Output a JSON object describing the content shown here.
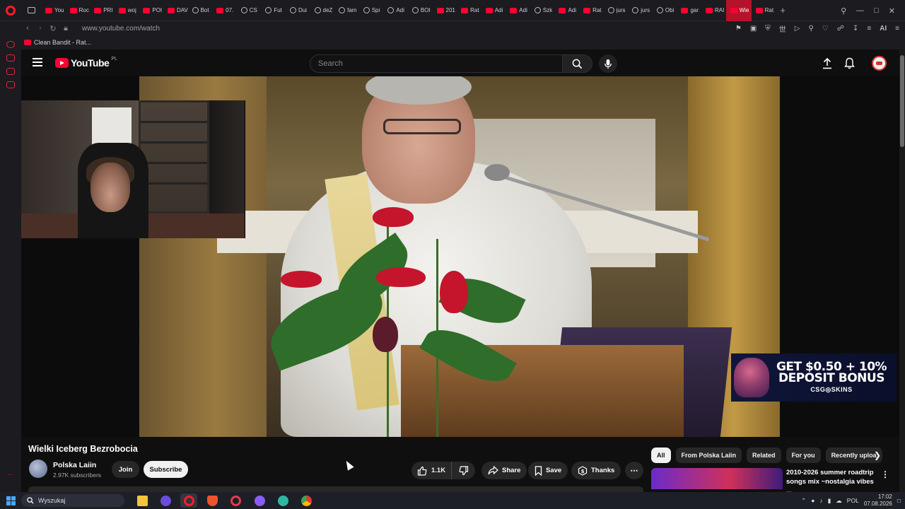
{
  "browser": {
    "tabs": [
      {
        "label": "You",
        "icon": "youtube-icon"
      },
      {
        "label": "Roc",
        "icon": "youtube-icon"
      },
      {
        "label": "PRI",
        "icon": "youtube-icon"
      },
      {
        "label": "woj",
        "icon": "youtube-icon"
      },
      {
        "label": "POI",
        "icon": "youtube-icon"
      },
      {
        "label": "DAV",
        "icon": "youtube-icon"
      },
      {
        "label": "Bot",
        "icon": "generic-icon"
      },
      {
        "label": "07.",
        "icon": "youtube-icon"
      },
      {
        "label": "CS",
        "icon": "generic-icon"
      },
      {
        "label": "Fut",
        "icon": "generic-icon"
      },
      {
        "label": "Dui",
        "icon": "maps-icon"
      },
      {
        "label": "deZ",
        "icon": "generic-icon"
      },
      {
        "label": "fam",
        "icon": "google-icon"
      },
      {
        "label": "Spi",
        "icon": "tiktok-icon"
      },
      {
        "label": "Adi",
        "icon": "tiktok-icon"
      },
      {
        "label": "BOI",
        "icon": "x-icon"
      },
      {
        "label": "201",
        "icon": "youtube-icon"
      },
      {
        "label": "Rat",
        "icon": "youtube-icon"
      },
      {
        "label": "Adi",
        "icon": "youtube-icon"
      },
      {
        "label": "Adi",
        "icon": "youtube-icon"
      },
      {
        "label": "Szk",
        "icon": "x-icon"
      },
      {
        "label": "Adi",
        "icon": "youtube-icon"
      },
      {
        "label": "Rat",
        "icon": "youtube-icon"
      },
      {
        "label": "jurs",
        "icon": "google-icon"
      },
      {
        "label": "jurs",
        "icon": "tiktok-icon"
      },
      {
        "label": "Obi",
        "icon": "amazon-icon"
      },
      {
        "label": "gar",
        "icon": "youtube-icon"
      },
      {
        "label": "RAI",
        "icon": "youtube-icon"
      },
      {
        "label": "Wie",
        "icon": "youtube-icon",
        "active": true
      },
      {
        "label": "Rat",
        "icon": "youtube-icon"
      }
    ],
    "url": "www.youtube.com/watch",
    "bookmark": "Clean Bandit - Rat..."
  },
  "youtube": {
    "logo_text": "YouTube",
    "country_code": "PL",
    "search_placeholder": "Search"
  },
  "video": {
    "title": "Wielki Iceberg Bezrobocia",
    "channel": "Polska Laiin",
    "subscribers": "2.97K subscribers",
    "join_label": "Join",
    "subscribe_label": "Subscribe",
    "likes": "1.1K",
    "share_label": "Share",
    "save_label": "Save",
    "thanks_label": "Thanks",
    "ad_line1": "GET $0.50 + 10%",
    "ad_line2": "DEPOSIT BONUS",
    "ad_brand": "CSG◎SKINS"
  },
  "related": {
    "chips": [
      "All",
      "From Polska Laiin",
      "Related",
      "For you",
      "Recently uploa"
    ],
    "first_title": "2010-2026 summer roadtrip songs mix ~nostalgia vibes ..."
  },
  "taskbar": {
    "search_placeholder": "Wyszukaj",
    "language": "POL",
    "time": "17:02",
    "date": "07.08.2026"
  },
  "colors": {
    "youtube_red": "#ff0033",
    "opera_red": "#ff1b2d",
    "background": "#0f0f0f"
  }
}
